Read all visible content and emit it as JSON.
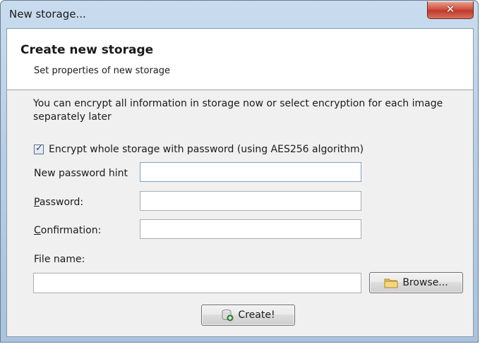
{
  "window": {
    "title": "New storage...",
    "close_glyph": "✕"
  },
  "header": {
    "title": "Create new storage",
    "subtitle": "Set properties of new storage"
  },
  "body": {
    "info_text": "You can encrypt all information in storage now or select encryption for each image separately later",
    "encrypt_checkbox": {
      "label": "Encrypt whole storage with password (using AES256 algorithm)",
      "checked": true
    },
    "fields": {
      "hint": {
        "label": "New password hint",
        "value": ""
      },
      "password": {
        "label_mnemonic": "P",
        "label_rest": "assword:",
        "value": ""
      },
      "confirmation": {
        "label_mnemonic": "C",
        "label_rest": "onfirmation:",
        "value": ""
      },
      "filename": {
        "label": "File name:",
        "value": ""
      }
    },
    "browse_button": {
      "label": "Browse...",
      "icon": "folder-icon"
    },
    "create_button": {
      "label": "Create!",
      "icon": "database-add-icon"
    }
  },
  "colors": {
    "title_bar": "#b8cfe6",
    "close_button": "#c0392b",
    "dialog_bg": "#f0f0f0",
    "focused_border": "#7da2ce"
  }
}
